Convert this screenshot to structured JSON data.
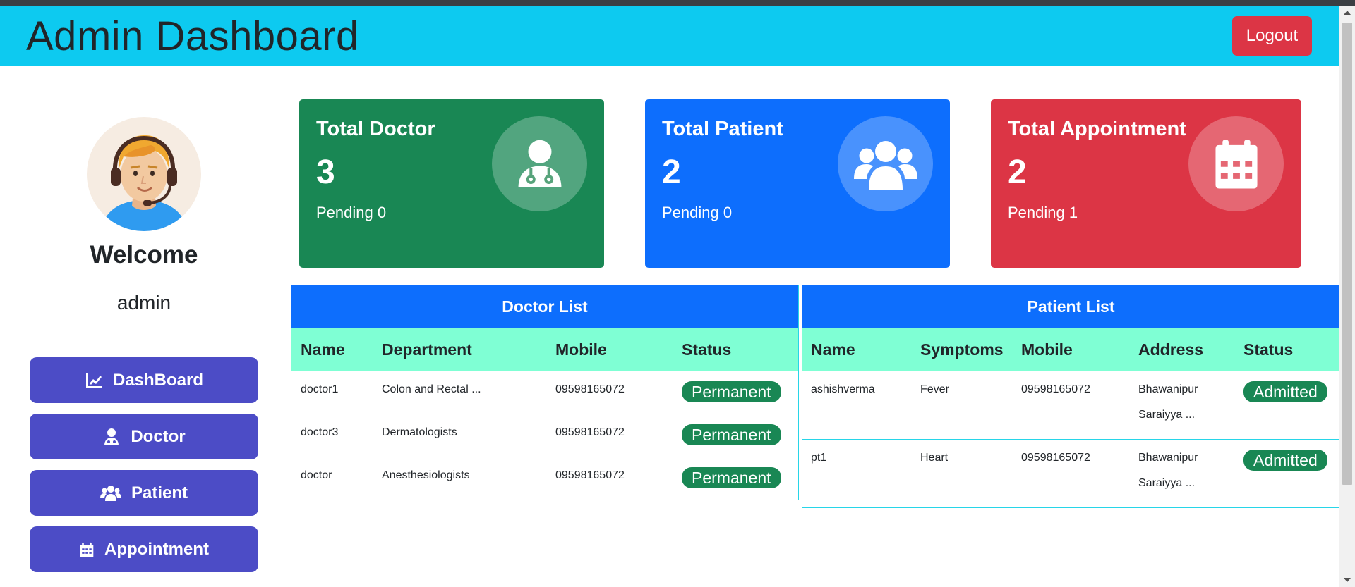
{
  "header": {
    "title": "Admin Dashboard",
    "logout_label": "Logout"
  },
  "sidebar": {
    "welcome": "Welcome",
    "username": "admin",
    "items": [
      {
        "label": "DashBoard",
        "icon": "chart-line-icon"
      },
      {
        "label": "Doctor",
        "icon": "user-doctor-icon"
      },
      {
        "label": "Patient",
        "icon": "users-icon"
      },
      {
        "label": "Appointment",
        "icon": "calendar-icon"
      }
    ]
  },
  "cards": [
    {
      "title": "Total Doctor",
      "count": "3",
      "pending": "Pending 0",
      "color": "#198754",
      "icon": "user-doctor-icon"
    },
    {
      "title": "Total Patient",
      "count": "2",
      "pending": "Pending 0",
      "color": "#0d6efd",
      "icon": "users-icon"
    },
    {
      "title": "Total Appointment",
      "count": "2",
      "pending": "Pending 1",
      "color": "#dc3545",
      "icon": "calendar-icon"
    }
  ],
  "doctor_list": {
    "title": "Doctor List",
    "columns": [
      "Name",
      "Department",
      "Mobile",
      "Status"
    ],
    "rows": [
      {
        "name": "doctor1",
        "department": "Colon and Rectal ...",
        "mobile": "09598165072",
        "status": "Permanent"
      },
      {
        "name": "doctor3",
        "department": "Dermatologists",
        "mobile": "09598165072",
        "status": "Permanent"
      },
      {
        "name": "doctor",
        "department": "Anesthesiologists",
        "mobile": "09598165072",
        "status": "Permanent"
      }
    ]
  },
  "patient_list": {
    "title": "Patient List",
    "columns": [
      "Name",
      "Symptoms",
      "Mobile",
      "Address",
      "Status"
    ],
    "rows": [
      {
        "name": "ashishverma",
        "symptoms": "Fever",
        "mobile": "09598165072",
        "address_line1": "Bhawanipur",
        "address_line2": "Saraiyya ...",
        "status": "Admitted"
      },
      {
        "name": "pt1",
        "symptoms": "Heart",
        "mobile": "09598165072",
        "address_line1": "Bhawanipur",
        "address_line2": "Saraiyya ...",
        "status": "Admitted"
      }
    ]
  },
  "colors": {
    "header_bg": "#0dcaf0",
    "sidebar_button": "#4c4cc6",
    "table_header": "#0d6efd",
    "table_col_header": "#7fffd4",
    "badge": "#198754",
    "logout": "#dc3545"
  }
}
